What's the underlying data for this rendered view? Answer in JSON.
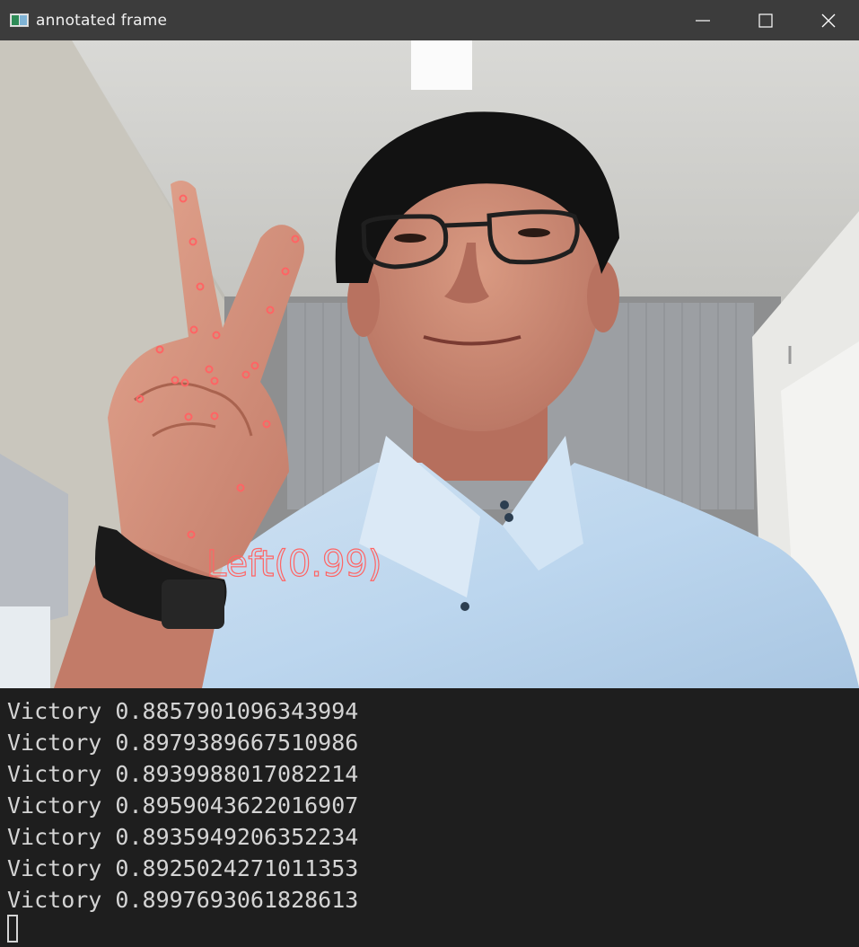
{
  "window": {
    "title": "annotated frame",
    "icon": "app-window-icon",
    "controls": {
      "minimize_icon": "minimize-icon",
      "maximize_icon": "maximize-icon",
      "close_icon": "close-icon"
    }
  },
  "frame": {
    "hand_label": "Left(0.99)",
    "landmark_color": "#ff6464",
    "landmark_count": 21
  },
  "console": {
    "lines": [
      "Victory 0.8857901096343994",
      "Victory 0.8979389667510986",
      "Victory 0.8939988017082214",
      "Victory 0.8959043622016907",
      "Victory 0.8935949206352234",
      "Victory 0.8925024271011353",
      "Victory 0.8997693061828613"
    ],
    "cursor": "block-cursor"
  }
}
